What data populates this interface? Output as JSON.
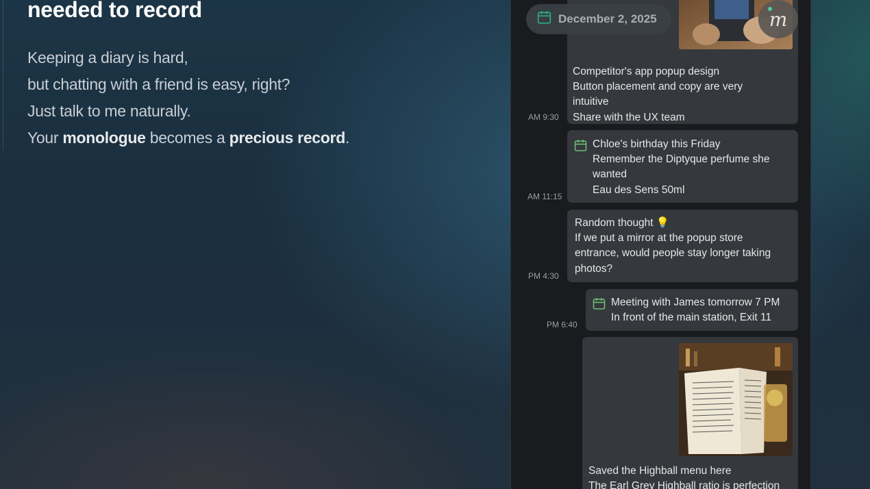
{
  "hero": {
    "title": "needed to record",
    "line1": "Keeping a diary is hard,",
    "line2": "but chatting with a friend is easy, right?",
    "line3": "Just talk to me naturally.",
    "line4_pre": "Your ",
    "line4_b1": "monologue",
    "line4_mid": " becomes a ",
    "line4_b2": "precious record",
    "line4_end": "."
  },
  "app": {
    "date_label": "December 2, 2025",
    "avatar_letter": "m",
    "accent_color": "#6fbf73",
    "messages": [
      {
        "time": "AM 9:30",
        "type": "photo-note",
        "icon": "photo-thumbnail",
        "lines": [
          "Competitor's app popup design",
          "Button placement and copy are very",
          "intuitive",
          "Share with the UX team"
        ]
      },
      {
        "time": "AM 11:15",
        "type": "calendar",
        "icon": "calendar-icon",
        "lines": [
          "Chloe's birthday this Friday",
          "Remember the Diptyque perfume she",
          "wanted",
          "Eau des Sens 50ml"
        ]
      },
      {
        "time": "PM 4:30",
        "type": "text",
        "icon": "lightbulb-emoji",
        "lines": [
          "Random thought 💡",
          "If we put a mirror at the popup store",
          "entrance, would people stay longer taking",
          "photos?"
        ]
      },
      {
        "time": "PM 6:40",
        "type": "calendar",
        "icon": "calendar-icon",
        "lines": [
          "Meeting with James tomorrow 7 PM",
          "In front of the main station, Exit 11"
        ]
      },
      {
        "time": "",
        "type": "photo-note",
        "icon": "menu-photo",
        "lines": [
          "Saved the Highball menu here",
          "The Earl Grey Highball ratio is perfection"
        ]
      }
    ]
  }
}
